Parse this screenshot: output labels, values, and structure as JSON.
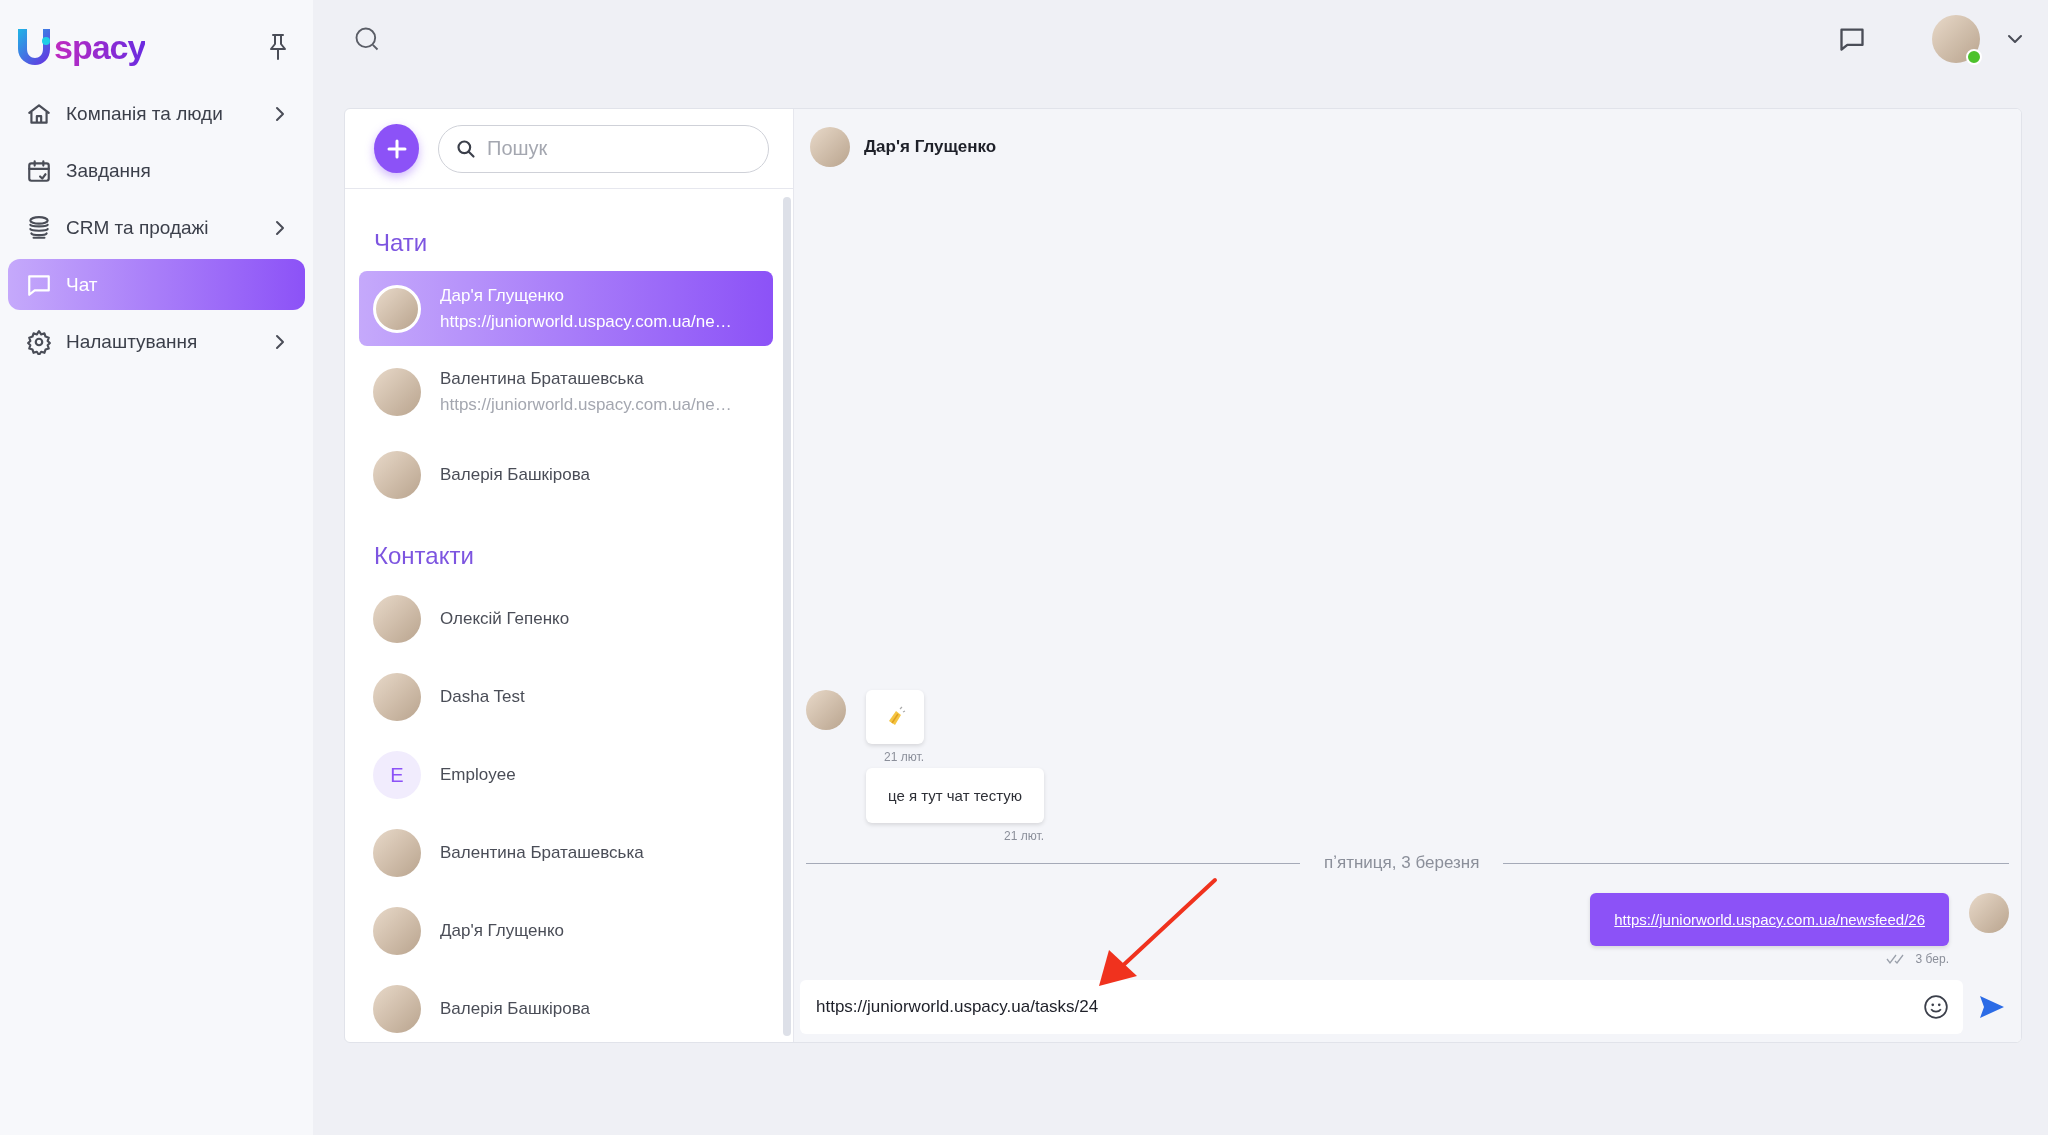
{
  "app": {
    "logo": "spacy"
  },
  "sidebar": {
    "items": [
      {
        "label": "Компанія та люди",
        "submenu": true,
        "selected": false
      },
      {
        "label": "Завдання",
        "submenu": false,
        "selected": false
      },
      {
        "label": "CRM та продажі",
        "submenu": true,
        "selected": false
      },
      {
        "label": "Чат",
        "submenu": false,
        "selected": true
      },
      {
        "label": "Налаштування",
        "submenu": true,
        "selected": false
      }
    ]
  },
  "user": {
    "online": true
  },
  "chat_list": {
    "search": {
      "placeholder": "Пошук"
    },
    "sections": [
      {
        "title": "Чати",
        "items": [
          {
            "name": "Дар'я Глущенко",
            "preview": "https://juniorworld.uspacy.com.ua/ne…",
            "selected": true
          },
          {
            "name": "Валентина Браташевська",
            "preview": "https://juniorworld.uspacy.com.ua/ne…",
            "selected": false
          },
          {
            "name": "Валерія Башкірова",
            "selected": false
          }
        ]
      },
      {
        "title": "Контакти",
        "items": [
          {
            "name": "Олексій Гепенко",
            "selected": false
          },
          {
            "name": "Dasha Test",
            "selected": false
          },
          {
            "name": "Employee",
            "initial": "E",
            "selected": false
          },
          {
            "name": "Валентина Браташевська",
            "selected": false
          },
          {
            "name": "Дар'я Глущенко",
            "selected": false
          },
          {
            "name": "Валерія Башкірова",
            "selected": false
          }
        ]
      }
    ]
  },
  "conversation": {
    "title": "Дар'я Глущенко",
    "messages": [
      {
        "kind": "sticker",
        "outgoing": false,
        "show_avatar": true,
        "time": "21 лют."
      },
      {
        "kind": "text",
        "outgoing": false,
        "show_avatar": false,
        "text": "це я тут чат тестую",
        "time": "21 лют."
      },
      {
        "kind": "divider",
        "text": "пʼятниця, 3 березня"
      },
      {
        "kind": "link",
        "outgoing": true,
        "show_avatar": true,
        "text": "https://juniorworld.uspacy.com.ua/newsfeed/26",
        "time": "3 бер.",
        "read": true
      }
    ],
    "composer": {
      "value": "https://juniorworld.uspacy.ua/tasks/24"
    }
  }
}
